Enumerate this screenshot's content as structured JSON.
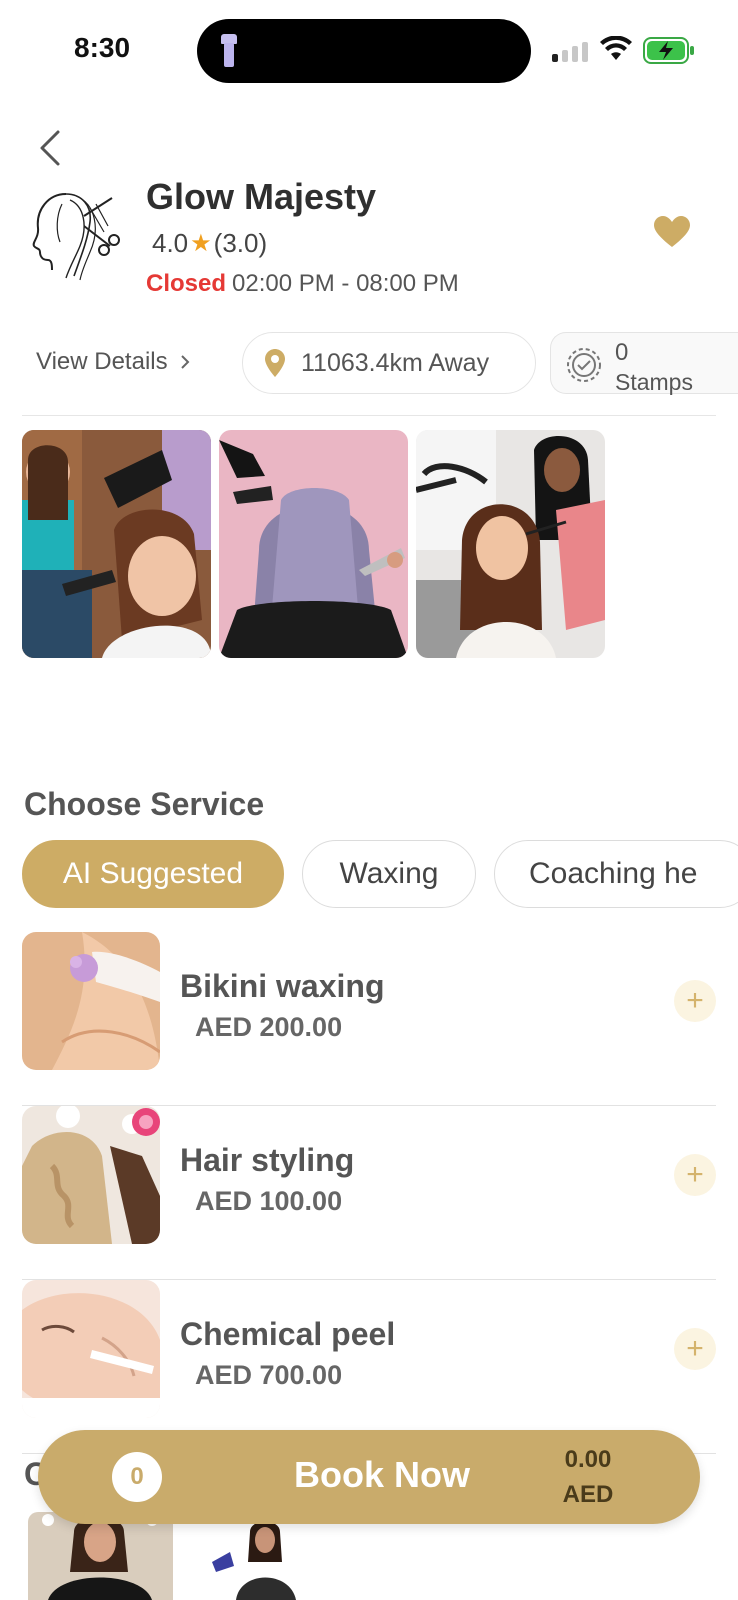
{
  "status_bar": {
    "time": "8:30"
  },
  "salon": {
    "name": "Glow Majesty",
    "rating": "4.0",
    "rating_count": "(3.0)",
    "status": "Closed",
    "hours": "02:00 PM - 08:00 PM"
  },
  "info": {
    "view_details": "View Details",
    "distance": "11063.4km Away",
    "stamps_count": "0",
    "stamps_label": "Stamps"
  },
  "gallery": {
    "photos": [
      "hair-salon-blowdry-photo",
      "purple-hair-cut-photo",
      "makeup-hair-styling-photo"
    ]
  },
  "services_section": {
    "title": "Choose Service",
    "tabs": [
      {
        "label": "AI Suggested",
        "active": true
      },
      {
        "label": "Waxing",
        "active": false
      },
      {
        "label": "Coaching he",
        "active": false
      }
    ],
    "items": [
      {
        "name": "Bikini waxing",
        "price": "AED 200.00",
        "icon": "plus-icon"
      },
      {
        "name": "Hair styling",
        "price": "AED 100.00",
        "icon": "plus-icon"
      },
      {
        "name": "Chemical peel",
        "price": "AED 700.00",
        "icon": "plus-icon"
      }
    ]
  },
  "next_section": {
    "title_visible": "C"
  },
  "book_bar": {
    "count": "0",
    "label": "Book Now",
    "amount": "0.00",
    "currency": "AED"
  },
  "colors": {
    "accent_gold": "#cdac65",
    "closed_red": "#e53935",
    "star_orange": "#f0a020"
  }
}
